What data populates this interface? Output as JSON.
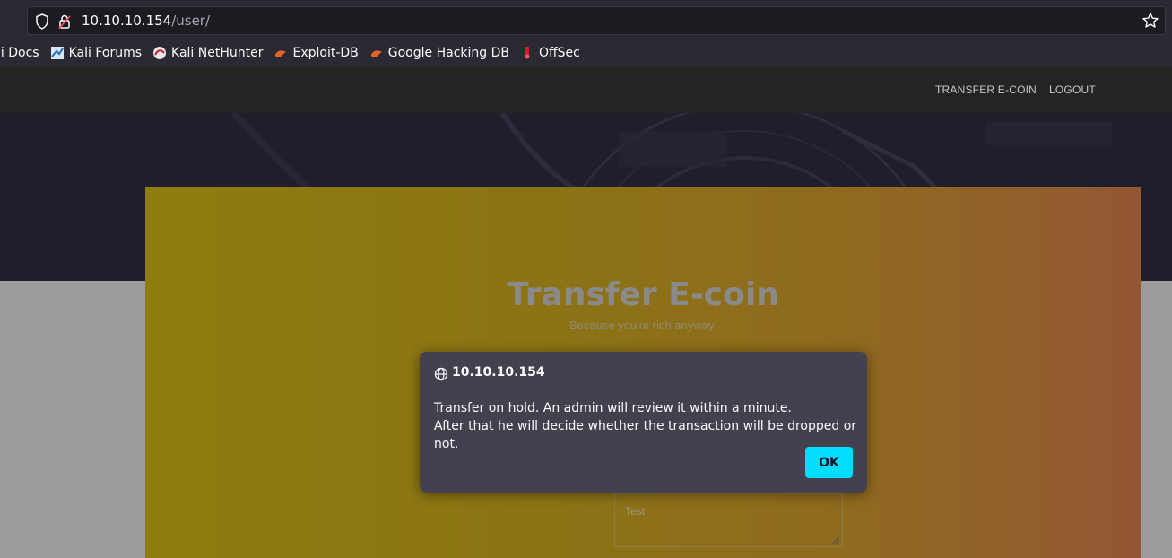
{
  "browser": {
    "url_host": "10.10.10.154",
    "url_path": "/user/",
    "bookmarks": [
      {
        "label": "li Docs",
        "icon": "kali-docs-icon"
      },
      {
        "label": "Kali Forums",
        "icon": "kali-forums-icon"
      },
      {
        "label": "Kali NetHunter",
        "icon": "kali-nethunter-icon"
      },
      {
        "label": "Exploit-DB",
        "icon": "exploit-db-icon"
      },
      {
        "label": "Google Hacking DB",
        "icon": "exploit-db-icon"
      },
      {
        "label": "OffSec",
        "icon": "offsec-icon"
      }
    ]
  },
  "nav": {
    "transfer_label": "TRANSFER E-COIN",
    "logout_label": "LOGOUT"
  },
  "card": {
    "title": "Transfer E-coin",
    "subtitle": "Because you're rich anyway.",
    "textarea_value": "Test"
  },
  "dialog": {
    "origin": "10.10.10.154",
    "message_line1": "Transfer on hold. An admin will review it within a minute.",
    "message_line2": "After that he will decide whether the transaction will be dropped or not.",
    "ok_label": "OK"
  },
  "colors": {
    "accent": "#00ddff",
    "dialog_bg": "#42414d",
    "chrome_bg": "#2b2a33"
  }
}
